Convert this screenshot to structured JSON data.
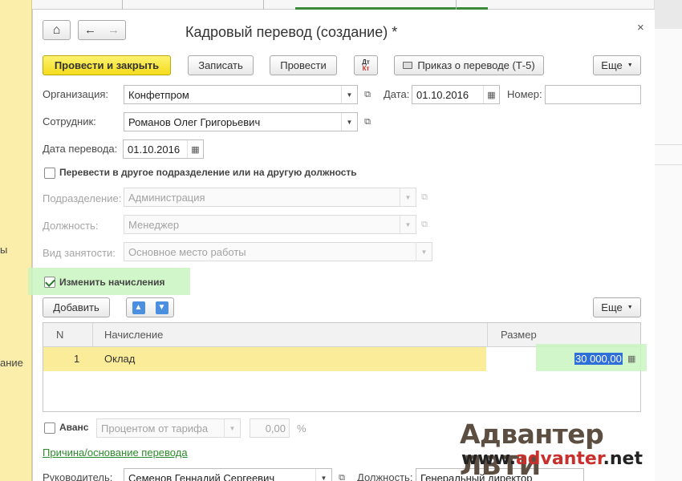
{
  "background": {
    "left_labels": [
      "ы",
      "ание"
    ]
  },
  "window": {
    "title": "Кадровый перевод (создание) *",
    "close_glyph": "×"
  },
  "nav": {
    "home_glyph": "⌂",
    "back_glyph": "←",
    "forward_glyph": "→"
  },
  "toolbar": {
    "post_and_close": "Провести и закрыть",
    "save": "Записать",
    "post": "Провести",
    "dtkt_top": "Дт",
    "dtkt_bottom": "Кт",
    "print_order": "Приказ о переводе (Т-5)",
    "more": "Еще"
  },
  "fields": {
    "organization_label": "Организация:",
    "organization_value": "Конфетпром",
    "date_label": "Дата:",
    "date_value": "01.10.2016",
    "number_label": "Номер:",
    "number_value": "",
    "employee_label": "Сотрудник:",
    "employee_value": "Романов Олег Григорьевич",
    "transfer_date_label": "Дата перевода:",
    "transfer_date_value": "01.10.2016",
    "transfer_checkbox_label": "Перевести в другое подразделение или на другую должность",
    "transfer_checked": false,
    "department_label": "Подразделение:",
    "department_value": "Администрация",
    "position_label": "Должность:",
    "position_value": "Менеджер",
    "employment_label": "Вид занятости:",
    "employment_value": "Основное место работы",
    "change_accruals_label": "Изменить начисления",
    "change_accruals_checked": true
  },
  "accruals": {
    "add_button": "Добавить",
    "more": "Еще",
    "columns": [
      "N",
      "Начисление",
      "Размер"
    ],
    "rows": [
      {
        "n": "1",
        "accrual": "Оклад",
        "amount": "30 000,00"
      }
    ]
  },
  "advance": {
    "label": "Аванс",
    "checked": false,
    "method_value": "Процентом от тарифа",
    "amount_value": "0,00",
    "unit": "%"
  },
  "reason_link": "Причина/основание перевода",
  "signer": {
    "manager_label": "Руководитель:",
    "manager_value": "Семенов Геннадий Сергеевич",
    "position_label": "Должность:",
    "position_value": "Генеральный директор"
  },
  "watermark": {
    "line1": "Адвантер ЛВТИ",
    "line2_prefix": "www.",
    "line2_brand": "advanter",
    "line2_suffix": ".net"
  },
  "colors": {
    "primary_button": "#f4dc1c",
    "highlight_green": "#c9f5c0",
    "row_yellow": "#fbec9a",
    "link_green": "#2b8a2b",
    "selection_blue": "#2e6fd8"
  }
}
